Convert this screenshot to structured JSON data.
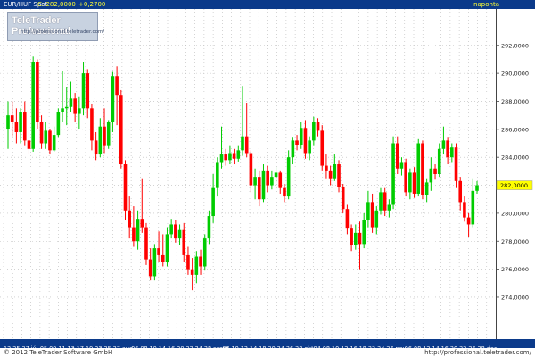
{
  "header": {
    "symbol": "EUR/HUF Spot",
    "close_label": "C: 282,0000",
    "change": "+0,2700",
    "period": "naponta"
  },
  "logo": {
    "title": "TeleTrader Professional",
    "url": "http://professional.teletrader.com/"
  },
  "footer": {
    "copyright": "© 2012 TeleTrader Software GmbH",
    "site": "http://professional.teletrader.com/"
  },
  "chart_data": {
    "type": "candlestick",
    "ylim": [
      271.0,
      294.6
    ],
    "y_ticks": [
      "274,0000",
      "276,0000",
      "278,0000",
      "280,0000",
      "282,0000",
      "284,0000",
      "286,0000",
      "288,0000",
      "290,0000",
      "292,0000"
    ],
    "y_tick_values": [
      274,
      276,
      278,
      280,
      282,
      284,
      286,
      288,
      290,
      292
    ],
    "last_price": "282,0000",
    "x_labels": [
      "12",
      "25",
      "27",
      "júl.",
      "05",
      "09",
      "11",
      "13",
      "17",
      "19",
      "23",
      "25",
      "27",
      "aug.",
      "06",
      "08",
      "10",
      "14",
      "16",
      "20",
      "22",
      "24",
      "28",
      "szept.",
      "06",
      "10",
      "12",
      "14",
      "18",
      "20",
      "24",
      "26",
      "28",
      "okt.",
      "04",
      "08",
      "10",
      "12",
      "16",
      "18",
      "22",
      "24",
      "26",
      "nov.",
      "06",
      "08",
      "12",
      "14",
      "16",
      "20",
      "22",
      "26",
      "28",
      "dec."
    ],
    "up_color": "#00cc00",
    "down_color": "#ff0000",
    "candles": [
      {
        "o": 286.0,
        "h": 288.0,
        "l": 284.6,
        "c": 287.0
      },
      {
        "o": 287.0,
        "h": 288.0,
        "l": 285.5,
        "c": 286.5
      },
      {
        "o": 286.5,
        "h": 287.5,
        "l": 285.0,
        "c": 285.8
      },
      {
        "o": 285.8,
        "h": 287.5,
        "l": 285.0,
        "c": 287.2
      },
      {
        "o": 287.2,
        "h": 288.0,
        "l": 284.8,
        "c": 285.2
      },
      {
        "o": 285.2,
        "h": 286.2,
        "l": 284.2,
        "c": 284.6
      },
      {
        "o": 284.6,
        "h": 291.2,
        "l": 284.4,
        "c": 290.8
      },
      {
        "o": 290.8,
        "h": 291.0,
        "l": 286.0,
        "c": 286.5
      },
      {
        "o": 286.5,
        "h": 287.0,
        "l": 284.6,
        "c": 285.0
      },
      {
        "o": 285.0,
        "h": 286.5,
        "l": 284.6,
        "c": 285.9
      },
      {
        "o": 285.9,
        "h": 286.0,
        "l": 284.2,
        "c": 284.5
      },
      {
        "o": 284.5,
        "h": 286.2,
        "l": 284.4,
        "c": 285.6
      },
      {
        "o": 285.6,
        "h": 287.5,
        "l": 285.4,
        "c": 287.2
      },
      {
        "o": 287.2,
        "h": 290.2,
        "l": 286.5,
        "c": 287.5
      },
      {
        "o": 287.5,
        "h": 289.0,
        "l": 286.3,
        "c": 287.6
      },
      {
        "o": 287.6,
        "h": 289.4,
        "l": 287.2,
        "c": 288.2
      },
      {
        "o": 288.2,
        "h": 288.6,
        "l": 286.5,
        "c": 287.1
      },
      {
        "o": 287.1,
        "h": 288.3,
        "l": 286.0,
        "c": 287.5
      },
      {
        "o": 287.5,
        "h": 290.8,
        "l": 287.0,
        "c": 290.0
      },
      {
        "o": 290.0,
        "h": 290.3,
        "l": 286.8,
        "c": 287.5
      },
      {
        "o": 287.5,
        "h": 287.8,
        "l": 284.5,
        "c": 285.2
      },
      {
        "o": 285.2,
        "h": 285.8,
        "l": 283.8,
        "c": 284.2
      },
      {
        "o": 284.2,
        "h": 286.8,
        "l": 284.0,
        "c": 286.2
      },
      {
        "o": 286.2,
        "h": 287.5,
        "l": 284.3,
        "c": 284.8
      },
      {
        "o": 284.8,
        "h": 286.6,
        "l": 284.6,
        "c": 286.5
      },
      {
        "o": 286.5,
        "h": 290.1,
        "l": 285.8,
        "c": 289.8
      },
      {
        "o": 289.8,
        "h": 290.5,
        "l": 286.3,
        "c": 288.4
      },
      {
        "o": 288.4,
        "h": 288.8,
        "l": 283.2,
        "c": 283.5
      },
      {
        "o": 283.5,
        "h": 283.8,
        "l": 279.5,
        "c": 280.2
      },
      {
        "o": 280.2,
        "h": 281.2,
        "l": 278.2,
        "c": 279.0
      },
      {
        "o": 279.0,
        "h": 280.5,
        "l": 277.6,
        "c": 278.0
      },
      {
        "o": 278.0,
        "h": 280.2,
        "l": 277.4,
        "c": 279.6
      },
      {
        "o": 279.6,
        "h": 282.5,
        "l": 278.6,
        "c": 279.0
      },
      {
        "o": 279.0,
        "h": 279.3,
        "l": 276.3,
        "c": 276.7
      },
      {
        "o": 276.7,
        "h": 277.5,
        "l": 275.2,
        "c": 275.5
      },
      {
        "o": 275.5,
        "h": 277.8,
        "l": 275.2,
        "c": 277.5
      },
      {
        "o": 277.5,
        "h": 278.7,
        "l": 276.5,
        "c": 277.0
      },
      {
        "o": 277.0,
        "h": 278.5,
        "l": 276.2,
        "c": 276.5
      },
      {
        "o": 276.5,
        "h": 279.0,
        "l": 276.2,
        "c": 278.5
      },
      {
        "o": 278.5,
        "h": 279.6,
        "l": 278.2,
        "c": 279.2
      },
      {
        "o": 279.2,
        "h": 279.5,
        "l": 277.9,
        "c": 278.2
      },
      {
        "o": 278.2,
        "h": 279.2,
        "l": 277.7,
        "c": 278.8
      },
      {
        "o": 278.8,
        "h": 279.3,
        "l": 276.5,
        "c": 277.0
      },
      {
        "o": 277.0,
        "h": 277.6,
        "l": 275.6,
        "c": 276.0
      },
      {
        "o": 276.0,
        "h": 276.8,
        "l": 274.5,
        "c": 275.6
      },
      {
        "o": 275.6,
        "h": 277.3,
        "l": 275.0,
        "c": 276.9
      },
      {
        "o": 276.9,
        "h": 277.4,
        "l": 275.6,
        "c": 276.2
      },
      {
        "o": 276.2,
        "h": 278.5,
        "l": 275.9,
        "c": 278.2
      },
      {
        "o": 278.2,
        "h": 280.2,
        "l": 277.8,
        "c": 279.8
      },
      {
        "o": 279.8,
        "h": 282.8,
        "l": 279.3,
        "c": 281.8
      },
      {
        "o": 281.8,
        "h": 284.0,
        "l": 281.2,
        "c": 283.6
      },
      {
        "o": 283.6,
        "h": 286.2,
        "l": 283.2,
        "c": 284.2
      },
      {
        "o": 284.2,
        "h": 284.6,
        "l": 283.4,
        "c": 283.8
      },
      {
        "o": 283.8,
        "h": 284.8,
        "l": 283.5,
        "c": 284.3
      },
      {
        "o": 284.3,
        "h": 284.6,
        "l": 283.5,
        "c": 283.9
      },
      {
        "o": 283.9,
        "h": 284.8,
        "l": 283.7,
        "c": 284.5
      },
      {
        "o": 284.5,
        "h": 289.1,
        "l": 284.1,
        "c": 285.5
      },
      {
        "o": 285.5,
        "h": 287.9,
        "l": 284.0,
        "c": 284.3
      },
      {
        "o": 284.3,
        "h": 284.5,
        "l": 281.5,
        "c": 282.0
      },
      {
        "o": 282.0,
        "h": 283.2,
        "l": 281.0,
        "c": 282.6
      },
      {
        "o": 282.6,
        "h": 283.0,
        "l": 280.5,
        "c": 281.0
      },
      {
        "o": 281.0,
        "h": 283.5,
        "l": 280.8,
        "c": 283.0
      },
      {
        "o": 283.0,
        "h": 283.4,
        "l": 281.5,
        "c": 282.0
      },
      {
        "o": 282.0,
        "h": 283.0,
        "l": 281.7,
        "c": 282.6
      },
      {
        "o": 282.6,
        "h": 283.3,
        "l": 282.2,
        "c": 282.9
      },
      {
        "o": 282.9,
        "h": 283.0,
        "l": 281.4,
        "c": 281.8
      },
      {
        "o": 281.8,
        "h": 282.1,
        "l": 280.8,
        "c": 281.2
      },
      {
        "o": 281.2,
        "h": 284.5,
        "l": 281.0,
        "c": 284.0
      },
      {
        "o": 284.0,
        "h": 285.4,
        "l": 283.5,
        "c": 285.2
      },
      {
        "o": 285.2,
        "h": 285.6,
        "l": 284.5,
        "c": 284.9
      },
      {
        "o": 284.9,
        "h": 286.5,
        "l": 284.6,
        "c": 286.1
      },
      {
        "o": 286.1,
        "h": 286.6,
        "l": 283.9,
        "c": 284.3
      },
      {
        "o": 284.3,
        "h": 285.5,
        "l": 283.8,
        "c": 285.2
      },
      {
        "o": 285.2,
        "h": 286.9,
        "l": 284.8,
        "c": 286.5
      },
      {
        "o": 286.5,
        "h": 286.8,
        "l": 285.5,
        "c": 285.9
      },
      {
        "o": 285.9,
        "h": 286.3,
        "l": 283.0,
        "c": 283.4
      },
      {
        "o": 283.4,
        "h": 284.2,
        "l": 282.5,
        "c": 283.0
      },
      {
        "o": 283.0,
        "h": 283.4,
        "l": 282.0,
        "c": 282.5
      },
      {
        "o": 282.5,
        "h": 284.2,
        "l": 282.3,
        "c": 283.5
      },
      {
        "o": 283.5,
        "h": 283.8,
        "l": 281.5,
        "c": 281.9
      },
      {
        "o": 281.9,
        "h": 282.1,
        "l": 280.0,
        "c": 280.3
      },
      {
        "o": 280.3,
        "h": 280.6,
        "l": 278.5,
        "c": 278.9
      },
      {
        "o": 278.9,
        "h": 279.2,
        "l": 277.3,
        "c": 277.7
      },
      {
        "o": 277.7,
        "h": 279.2,
        "l": 277.4,
        "c": 278.6
      },
      {
        "o": 278.6,
        "h": 279.4,
        "l": 276.0,
        "c": 277.8
      },
      {
        "o": 277.8,
        "h": 280.0,
        "l": 277.5,
        "c": 279.5
      },
      {
        "o": 279.5,
        "h": 281.6,
        "l": 279.0,
        "c": 280.8
      },
      {
        "o": 280.8,
        "h": 281.4,
        "l": 278.6,
        "c": 279.0
      },
      {
        "o": 279.0,
        "h": 280.5,
        "l": 278.5,
        "c": 280.2
      },
      {
        "o": 280.2,
        "h": 281.8,
        "l": 279.9,
        "c": 281.5
      },
      {
        "o": 281.5,
        "h": 281.8,
        "l": 279.8,
        "c": 280.2
      },
      {
        "o": 280.2,
        "h": 281.0,
        "l": 279.7,
        "c": 280.6
      },
      {
        "o": 280.6,
        "h": 285.5,
        "l": 280.3,
        "c": 285.0
      },
      {
        "o": 285.0,
        "h": 285.5,
        "l": 282.8,
        "c": 283.2
      },
      {
        "o": 283.2,
        "h": 284.0,
        "l": 282.7,
        "c": 283.6
      },
      {
        "o": 283.6,
        "h": 283.9,
        "l": 281.2,
        "c": 281.5
      },
      {
        "o": 281.5,
        "h": 283.2,
        "l": 281.0,
        "c": 282.9
      },
      {
        "o": 282.9,
        "h": 283.3,
        "l": 281.1,
        "c": 281.4
      },
      {
        "o": 281.4,
        "h": 285.3,
        "l": 281.2,
        "c": 285.0
      },
      {
        "o": 285.0,
        "h": 285.2,
        "l": 281.0,
        "c": 281.3
      },
      {
        "o": 281.3,
        "h": 282.5,
        "l": 280.8,
        "c": 282.2
      },
      {
        "o": 282.2,
        "h": 284.0,
        "l": 281.6,
        "c": 283.2
      },
      {
        "o": 283.2,
        "h": 283.5,
        "l": 282.4,
        "c": 282.8
      },
      {
        "o": 282.8,
        "h": 285.0,
        "l": 282.6,
        "c": 284.6
      },
      {
        "o": 284.6,
        "h": 286.2,
        "l": 284.2,
        "c": 285.2
      },
      {
        "o": 285.2,
        "h": 285.4,
        "l": 283.5,
        "c": 284.0
      },
      {
        "o": 284.0,
        "h": 285.0,
        "l": 283.6,
        "c": 284.7
      },
      {
        "o": 284.7,
        "h": 285.0,
        "l": 281.8,
        "c": 282.3
      },
      {
        "o": 282.3,
        "h": 282.6,
        "l": 280.2,
        "c": 280.8
      },
      {
        "o": 280.8,
        "h": 281.2,
        "l": 279.4,
        "c": 279.7
      },
      {
        "o": 279.7,
        "h": 280.0,
        "l": 278.3,
        "c": 279.2
      },
      {
        "o": 279.2,
        "h": 282.5,
        "l": 279.0,
        "c": 281.6
      },
      {
        "o": 281.6,
        "h": 282.3,
        "l": 281.4,
        "c": 282.0
      }
    ]
  }
}
